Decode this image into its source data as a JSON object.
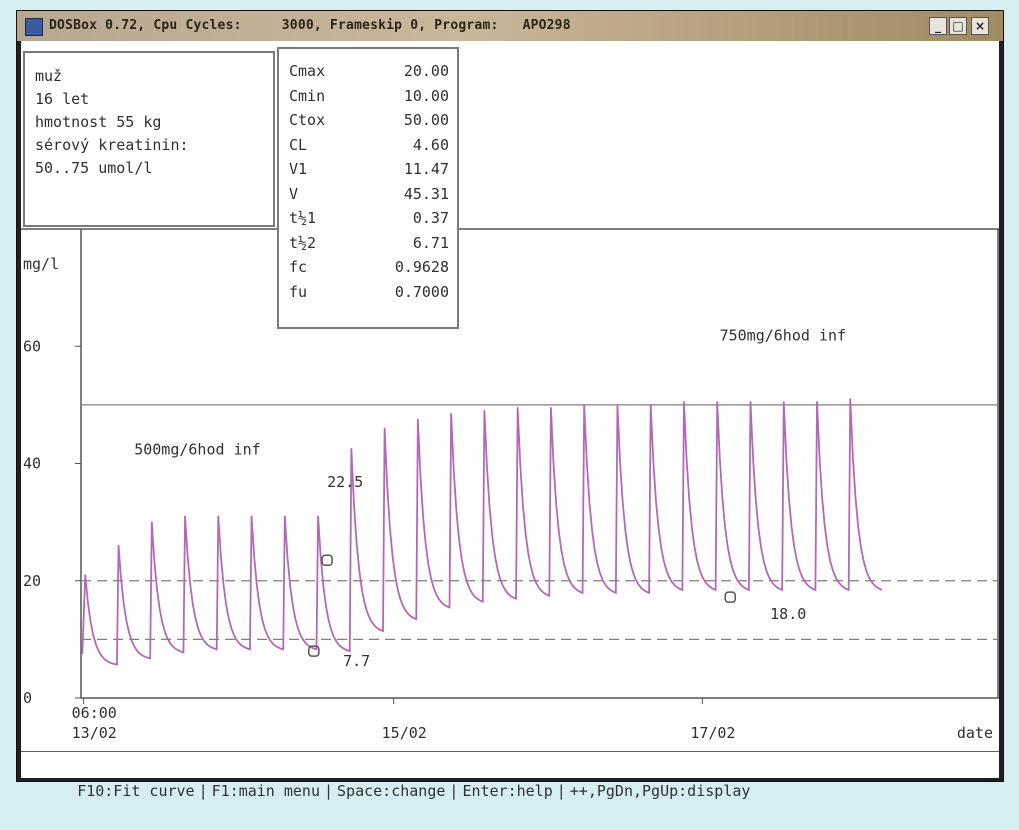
{
  "window": {
    "title": "DOSBox 0.72, Cpu Cycles:     3000, Frameskip 0, Program:   APO298",
    "buttons": {
      "minimize": "_",
      "maximize": "□",
      "close": "×"
    }
  },
  "patient_info": [
    "muž",
    "16 let",
    "hmotnost 55 kg",
    "sérový kreatinin:",
    "50..75 umol/l"
  ],
  "parameters": [
    {
      "name": "Cmax",
      "value": "20.00"
    },
    {
      "name": "Cmin",
      "value": "10.00"
    },
    {
      "name": "Ctox",
      "value": "50.00"
    },
    {
      "name": "CL",
      "value": "4.60"
    },
    {
      "name": "V1",
      "value": "11.47"
    },
    {
      "name": "V",
      "value": "45.31"
    },
    {
      "name": "t½1",
      "value": "0.37"
    },
    {
      "name": "t½2",
      "value": "6.71"
    },
    {
      "name": "fc",
      "value": "0.9628"
    },
    {
      "name": "fu",
      "value": "0.7000"
    }
  ],
  "chart_data": {
    "type": "line",
    "ylabel": "mg/l",
    "y_ticks": [
      "60",
      "40",
      "20",
      "0"
    ],
    "x_ticks": [
      {
        "top": "06:00",
        "bottom": "13/02"
      },
      {
        "top": "",
        "bottom": "15/02"
      },
      {
        "top": "",
        "bottom": "17/02"
      }
    ],
    "xlabel": "date",
    "ylim": [
      0,
      80
    ],
    "xlim": [
      0,
      6.9
    ],
    "reference_lines": [
      {
        "value": 50,
        "style": "solid"
      },
      {
        "value": 20,
        "style": "dashed"
      },
      {
        "value": 10,
        "style": "dashed"
      }
    ],
    "dose_labels": [
      {
        "text": "500mg/6hod inf",
        "x": 0.4,
        "y": 41.5
      },
      {
        "text": "750mg/6hod inf",
        "x": 4.8,
        "y": 61
      }
    ],
    "annotations": [
      {
        "text": "22.5",
        "x": 1.85,
        "y": 36
      },
      {
        "text": "7.7",
        "x": 1.97,
        "y": 5.5
      },
      {
        "text": "18.0",
        "x": 5.18,
        "y": 13.5
      }
    ],
    "markers": [
      {
        "x": 1.75,
        "y": 8.0
      },
      {
        "x": 1.85,
        "y": 23.5
      },
      {
        "x": 4.88,
        "y": 17.2
      }
    ],
    "series": [
      {
        "color": "#b468b8",
        "peaks": [
          {
            "x": 0.02,
            "value": 21,
            "trough": 5.5
          },
          {
            "x": 0.27,
            "value": 26,
            "trough": 6.5
          },
          {
            "x": 0.52,
            "value": 30,
            "trough": 7.5
          },
          {
            "x": 0.77,
            "value": 31,
            "trough": 8
          },
          {
            "x": 1.02,
            "value": 31,
            "trough": 8
          },
          {
            "x": 1.27,
            "value": 31,
            "trough": 8
          },
          {
            "x": 1.52,
            "value": 31,
            "trough": 8
          },
          {
            "x": 1.77,
            "value": 31,
            "trough": 7.7
          },
          {
            "x": 2.02,
            "value": 42.5,
            "trough": 11
          },
          {
            "x": 2.27,
            "value": 46,
            "trough": 13
          },
          {
            "x": 2.52,
            "value": 47.5,
            "trough": 15
          },
          {
            "x": 2.77,
            "value": 48.5,
            "trough": 16
          },
          {
            "x": 3.02,
            "value": 49,
            "trough": 16.5
          },
          {
            "x": 3.27,
            "value": 49.5,
            "trough": 17
          },
          {
            "x": 3.52,
            "value": 49.5,
            "trough": 17.5
          },
          {
            "x": 3.77,
            "value": 50,
            "trough": 17.5
          },
          {
            "x": 4.02,
            "value": 50,
            "trough": 17.5
          },
          {
            "x": 4.27,
            "value": 50,
            "trough": 18
          },
          {
            "x": 4.52,
            "value": 50.5,
            "trough": 18
          },
          {
            "x": 4.77,
            "value": 50.5,
            "trough": 18
          },
          {
            "x": 5.02,
            "value": 50.5,
            "trough": 18
          },
          {
            "x": 5.27,
            "value": 50.5,
            "trough": 18
          },
          {
            "x": 5.52,
            "value": 50.5,
            "trough": 18
          },
          {
            "x": 5.77,
            "value": 51,
            "trough": 18
          }
        ]
      }
    ]
  },
  "statusbar": {
    "items": [
      "F10:Fit curve",
      "F1:main menu",
      "Space:change",
      "Enter:help",
      "++,PgDn,PgUp:display"
    ],
    "separator": "|"
  }
}
